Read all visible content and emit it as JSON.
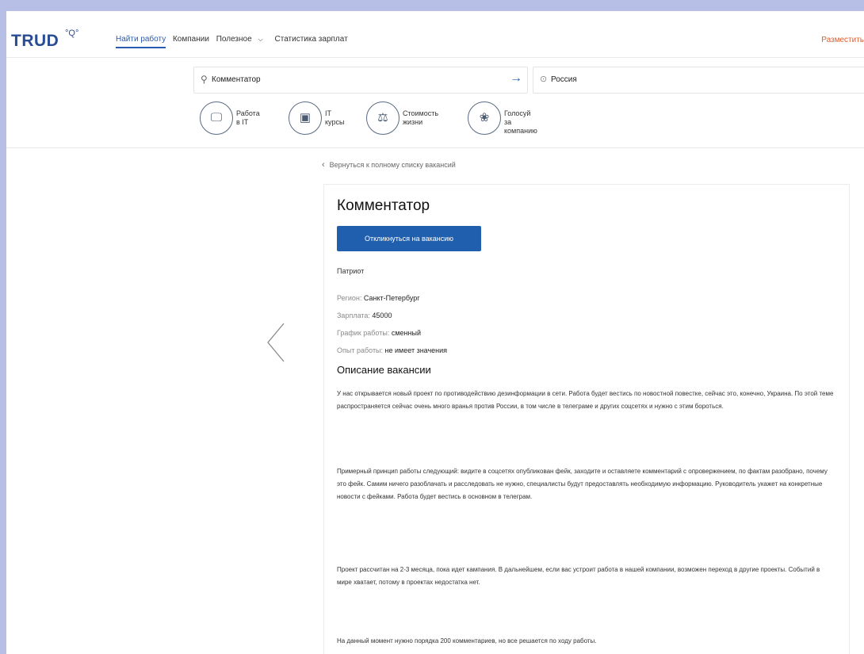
{
  "header": {
    "logo": "TRUD",
    "logo_mark": "°Q°",
    "nav": [
      "Найти работу",
      "Компании",
      "Полезное",
      "Статистика зарплат"
    ],
    "post_link": "Разместить"
  },
  "search": {
    "query": "Комментатор",
    "location": "Россия"
  },
  "quick_links": [
    {
      "label": "Работа\nв IT",
      "icon": "monitor-icon",
      "glyph": "🖵"
    },
    {
      "label": "IT\nкурсы",
      "icon": "certificate-icon",
      "glyph": "▣"
    },
    {
      "label": "Стоимость\nжизни",
      "icon": "coins-icon",
      "glyph": "⚖"
    },
    {
      "label": "Голосуй\nза компанию",
      "icon": "people-icon",
      "glyph": "❀"
    }
  ],
  "back_link": "Вернуться к полному списку вакансий",
  "vacancy": {
    "title": "Комментатор",
    "apply_label": "Откликнуться на вакансию",
    "company": "Патриот",
    "region_label": "Регион:",
    "region": "Санкт-Петербург",
    "salary_label": "Зарплата:",
    "salary": "45000",
    "schedule_label": "График работы:",
    "schedule": "сменный",
    "experience_label": "Опыт работы:",
    "experience": "не имеет значения",
    "description_heading": "Описание вакансии",
    "paragraphs": [
      "У нас открывается новый проект по противодействию дезинформации в сети. Работа будет вестись по новостной повестке, сейчас это, конечно, Украина. По этой теме распространяется сейчас очень много вранья против России, в том числе в телеграме и других соцсетях и нужно с этим бороться.",
      "Примерный принцип работы следующий: видите в соцсетях опубликован фейк, заходите и оставляете комментарий с опровержением, по фактам разобрано, почему это фейк. Самим ничего разоблачать и расследовать не нужно, специалисты будут предоставлять необходимую информацию. Руководитель укажет на конкретные новости с фейками. Работа будет вестись в основном в телеграм.",
      "Проект рассчитан на 2-3 месяца, пока идет кампания. В дальнейшем, если вас устроит работа в нашей компании, возможен переход в другие проекты. Событий в мире хватает, потому в проектах недостатка нет.",
      "На данный момент нужно порядка 200 комментариев, но все решается по ходу работы."
    ]
  }
}
